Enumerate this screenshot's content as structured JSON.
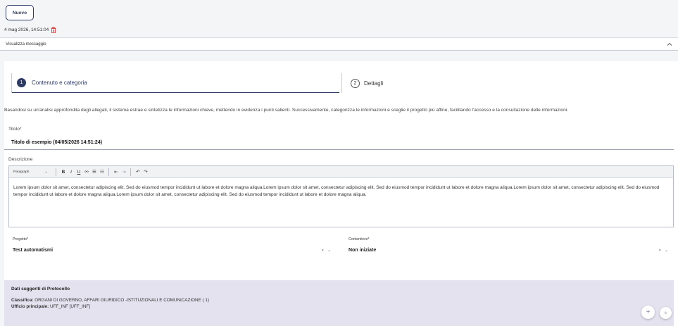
{
  "toolbar": {
    "new_label": "Nuovo"
  },
  "message": {
    "timestamp": "4 mag 2026, 14:51:04",
    "view_label": "Visualizza messaggio"
  },
  "steps": [
    {
      "number": "1",
      "label": "Contenuto e categoria"
    },
    {
      "number": "2",
      "label": "Dettagli"
    }
  ],
  "intro_text": "Basandosi su un'analisi approfondita degli allegati, il sistema estrae e sintetizza le informazioni chiave, mettendo in evidenza i punti salienti. Successivamente, categorizza le informazioni e sceglie il progetto più affine, facilitando l'accesso e la consultazione delle informazioni.",
  "form": {
    "title_label": "Titolo*",
    "title_value": "Titolo di esempio (04/05/2026 14:51:24)",
    "description_label": "Descrizione",
    "editor": {
      "paragraph_label": "Paragraph",
      "body": "Lorem ipsum dolor sit amet, consectetur adipiscing elit. Sed do eiusmod tempor incididunt ut labore et dolore magna aliqua.Lorem ipsum dolor sit amet, consectetur adipiscing elit. Sed do eiusmod tempor incididunt ut labore et dolore magna aliqua.Lorem ipsum dolor sit amet, consectetur adipiscing elit. Sed do eiusmod tempor incididunt ut labore et dolore magna aliqua.Lorem ipsum dolor sit amet, consectetur adipiscing elit. Sed do eiusmod tempor incididunt ut labore et dolore magna aliqua."
    },
    "project_label": "Progetto*",
    "project_value": "Test automatismi",
    "container_label": "Contenitore*",
    "container_value": "Non iniziate"
  },
  "protocol": {
    "title": "Dati suggeriti di Protocollo",
    "classifica_label": "Classifica:",
    "classifica_value": "ORGANI DI GOVERNO, AFFARI GIURIDICO -ISTITUZIONALI E COMUNICAZIONE ( 1)",
    "ufficio_label": "Ufficio principale:",
    "ufficio_value": "UFF_INF [UFF_INF]"
  },
  "colors": {
    "accent": "#2d3a63",
    "protocol_bg": "#e4e2ef",
    "trash": "#d32f2f"
  }
}
